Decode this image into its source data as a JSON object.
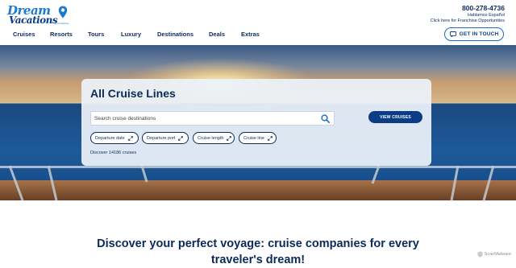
{
  "brand": {
    "logo_top": "Dream",
    "logo_bottom": "Vacations",
    "logo_tagline": "by CruiseOne"
  },
  "contact": {
    "phone": "800-278-4736",
    "spanish": "Hablamos Español",
    "franchise": "Click here for Franchise Opportunities"
  },
  "nav": {
    "items": [
      "Cruises",
      "Resorts",
      "Tours",
      "Luxury",
      "Destinations",
      "Deals",
      "Extras"
    ]
  },
  "get_in_touch": {
    "label": "GET IN TOUCH",
    "icon": "chat-icon"
  },
  "search_card": {
    "title": "All Cruise Lines",
    "search_placeholder": "Search cruise destinations",
    "view_button": "VIEW CRUISES",
    "filters": [
      "Departure date",
      "Departure port",
      "Cruise length",
      "Cruise line"
    ],
    "count_text": "Discover 14186 cruises"
  },
  "headline": {
    "line1": "Discover your perfect voyage: cruise companies for every",
    "line2": "traveler's dream!"
  },
  "badge": {
    "text": "ScanMalware",
    "icon": "shield-icon"
  },
  "colors": {
    "navy": "#0b2a5b",
    "brand_blue": "#1a7bd1",
    "button_blue": "#0b3d86"
  }
}
